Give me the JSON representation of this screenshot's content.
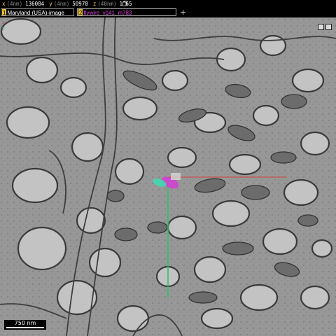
{
  "position": {
    "x": {
      "label": "x",
      "unit": "(4nm)",
      "value": "136084"
    },
    "y": {
      "label": "y",
      "unit": "(4nm)",
      "value": "50978"
    },
    "z": {
      "label": "z",
      "unit": "(40nm)",
      "value": "1165"
    }
  },
  "layers": [
    {
      "index": "1",
      "name": "Maryland (USA)-image"
    },
    {
      "index": "2",
      "name": "flywire_v141_m783"
    }
  ],
  "add_layer": "+",
  "axes": {
    "x": "x",
    "y": "y"
  },
  "scale_bar": "750 nm",
  "colors": {
    "x_axis": "#d04040",
    "y_axis": "#30c060",
    "segment_magenta": "#d040d0",
    "segment_cyan": "#40d8b0"
  }
}
